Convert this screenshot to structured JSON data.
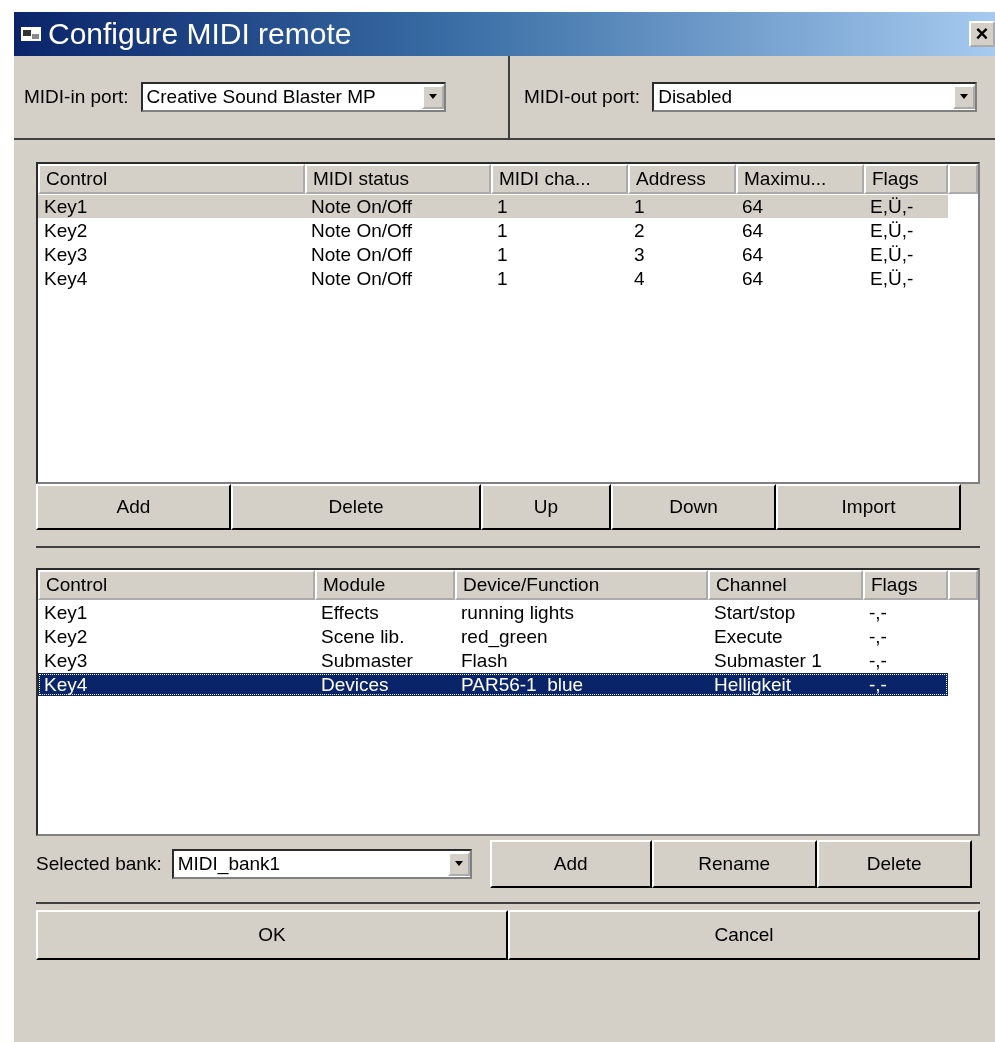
{
  "window": {
    "title": "Configure MIDI remote",
    "close": "×"
  },
  "ports": [
    {
      "label": "MIDI-in port:",
      "value": "Creative Sound Blaster MP"
    },
    {
      "label": "MIDI-out port:",
      "value": "Disabled"
    }
  ],
  "midi_table": {
    "focused": false,
    "columns": [
      "Control",
      "MIDI status",
      "MIDI cha...",
      "Address",
      "Maximu...",
      "Flags"
    ],
    "rows": [
      {
        "cells": [
          "Key1",
          "Note On/Off",
          "1",
          "1",
          "64",
          "E,Ü,-"
        ],
        "selected": true
      },
      {
        "cells": [
          "Key2",
          "Note On/Off",
          "1",
          "2",
          "64",
          "E,Ü,-"
        ],
        "selected": false
      },
      {
        "cells": [
          "Key3",
          "Note On/Off",
          "1",
          "3",
          "64",
          "E,Ü,-"
        ],
        "selected": false
      },
      {
        "cells": [
          "Key4",
          "Note On/Off",
          "1",
          "4",
          "64",
          "E,Ü,-"
        ],
        "selected": false
      }
    ]
  },
  "midi_buttons": [
    "Add",
    "Delete",
    "Up",
    "Down",
    "Import"
  ],
  "assign_table": {
    "focused": true,
    "columns": [
      "Control",
      "Module",
      "Device/Function",
      "Channel",
      "Flags"
    ],
    "rows": [
      {
        "cells": [
          "Key1",
          "Effects",
          "running lights",
          "Start/stop",
          "-,-"
        ],
        "selected": false
      },
      {
        "cells": [
          "Key2",
          "Scene lib.",
          "red_green",
          "Execute",
          "-,-"
        ],
        "selected": false
      },
      {
        "cells": [
          "Key3",
          "Submaster",
          "Flash",
          "Submaster 1",
          "-,-"
        ],
        "selected": false
      },
      {
        "cells": [
          "Key4",
          "Devices",
          "PAR56-1  blue",
          "Helligkeit",
          "-,-"
        ],
        "selected": true
      }
    ]
  },
  "bank": {
    "label": "Selected bank:",
    "value": "MIDI_bank1"
  },
  "bank_buttons": [
    "Add",
    "Rename",
    "Delete"
  ],
  "dialog_buttons": [
    "OK",
    "Cancel"
  ]
}
